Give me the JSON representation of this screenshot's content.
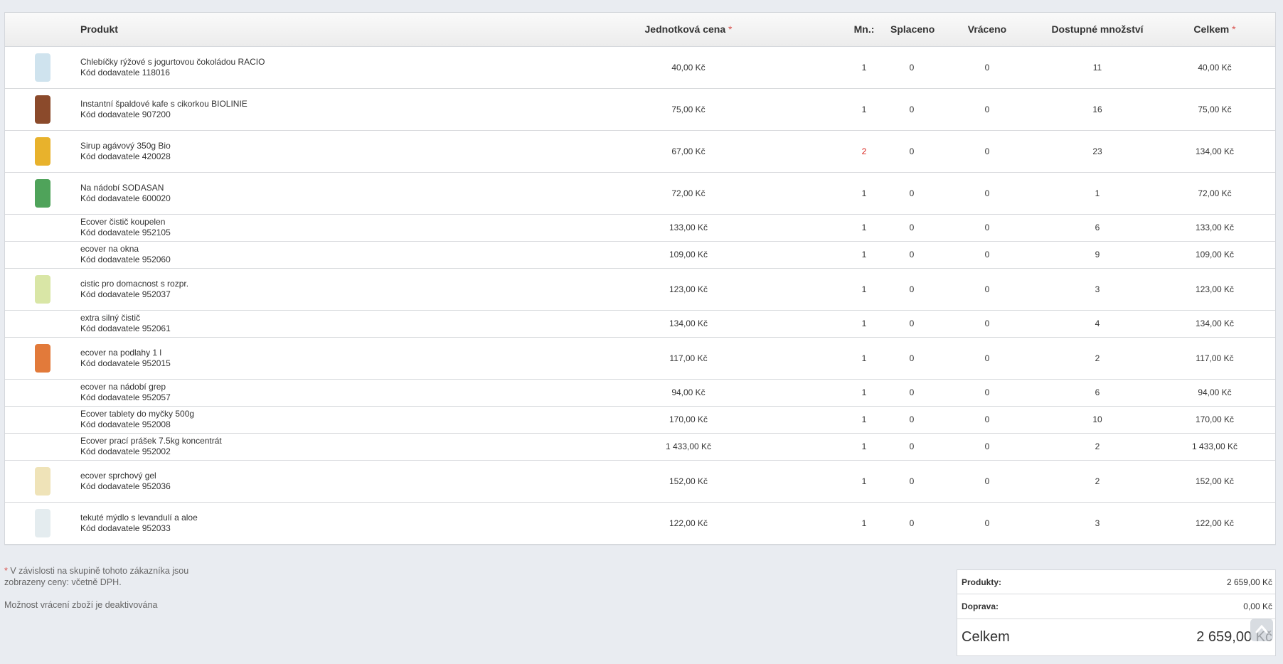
{
  "table": {
    "headers": {
      "product": "Produkt",
      "unit_price": "Jednotková cena",
      "qty": "Mn.:",
      "paid": "Splaceno",
      "returned": "Vráceno",
      "available": "Dostupné množství",
      "total": "Celkem",
      "asterisk": "*"
    },
    "rows": [
      {
        "name": "Chlebíčky rýžové s jogurtovou čokoládou RACIO",
        "code": "Kód dodavatele 118016",
        "price": "40,00 Kč",
        "qty": "1",
        "paid": "0",
        "returned": "0",
        "available": "11",
        "total": "40,00 Kč",
        "image": "light-blue-package",
        "img_color": "#cfe3ee"
      },
      {
        "name": "Instantní špaldové kafe s cikorkou BIOLINIE",
        "code": "Kód dodavatele 907200",
        "price": "75,00 Kč",
        "qty": "1",
        "paid": "0",
        "returned": "0",
        "available": "16",
        "total": "75,00 Kč",
        "image": "brown-can",
        "img_color": "#8b4a2b"
      },
      {
        "name": "Sirup agávový 350g Bio",
        "code": "Kód dodavatele 420028",
        "price": "67,00 Kč",
        "qty": "2",
        "paid": "0",
        "returned": "0",
        "available": "23",
        "total": "134,00 Kč",
        "image": "yellow-bottle",
        "img_color": "#e8b22c"
      },
      {
        "name": "Na nádobí SODASAN",
        "code": "Kód dodavatele 600020",
        "price": "72,00 Kč",
        "qty": "1",
        "paid": "0",
        "returned": "0",
        "available": "1",
        "total": "72,00 Kč",
        "image": "green-bottle",
        "img_color": "#4fa35a"
      },
      {
        "name": "Ecover čistič koupelen",
        "code": "Kód dodavatele 952105",
        "price": "133,00 Kč",
        "qty": "1",
        "paid": "0",
        "returned": "0",
        "available": "6",
        "total": "133,00 Kč",
        "image": "",
        "img_color": ""
      },
      {
        "name": "ecover na okna",
        "code": "Kód dodavatele 952060",
        "price": "109,00 Kč",
        "qty": "1",
        "paid": "0",
        "returned": "0",
        "available": "9",
        "total": "109,00 Kč",
        "image": "",
        "img_color": ""
      },
      {
        "name": "cistic pro domacnost s rozpr.",
        "code": "Kód dodavatele 952037",
        "price": "123,00 Kč",
        "qty": "1",
        "paid": "0",
        "returned": "0",
        "available": "3",
        "total": "123,00 Kč",
        "image": "spray-bottle",
        "img_color": "#d9e6a6"
      },
      {
        "name": "extra silný čistič",
        "code": "Kód dodavatele 952061",
        "price": "134,00 Kč",
        "qty": "1",
        "paid": "0",
        "returned": "0",
        "available": "4",
        "total": "134,00 Kč",
        "image": "",
        "img_color": ""
      },
      {
        "name": "ecover na podlahy 1 l",
        "code": "Kód dodavatele 952015",
        "price": "117,00 Kč",
        "qty": "1",
        "paid": "0",
        "returned": "0",
        "available": "2",
        "total": "117,00 Kč",
        "image": "orange-bottle",
        "img_color": "#e27a3a"
      },
      {
        "name": "ecover na nádobí grep",
        "code": "Kód dodavatele 952057",
        "price": "94,00 Kč",
        "qty": "1",
        "paid": "0",
        "returned": "0",
        "available": "6",
        "total": "94,00 Kč",
        "image": "",
        "img_color": ""
      },
      {
        "name": "Ecover tablety do myčky 500g",
        "code": "Kód dodavatele 952008",
        "price": "170,00 Kč",
        "qty": "1",
        "paid": "0",
        "returned": "0",
        "available": "10",
        "total": "170,00 Kč",
        "image": "",
        "img_color": ""
      },
      {
        "name": "Ecover prací prášek 7.5kg koncentrát",
        "code": "Kód dodavatele 952002",
        "price": "1 433,00 Kč",
        "qty": "1",
        "paid": "0",
        "returned": "0",
        "available": "2",
        "total": "1 433,00 Kč",
        "image": "",
        "img_color": ""
      },
      {
        "name": "ecover sprchový gel",
        "code": "Kód dodavatele 952036",
        "price": "152,00 Kč",
        "qty": "1",
        "paid": "0",
        "returned": "0",
        "available": "2",
        "total": "152,00 Kč",
        "image": "cream-bottle",
        "img_color": "#efe3b8"
      },
      {
        "name": "tekuté mýdlo s levandulí a aloe",
        "code": "Kód dodavatele 952033",
        "price": "122,00 Kč",
        "qty": "1",
        "paid": "0",
        "returned": "0",
        "available": "3",
        "total": "122,00 Kč",
        "image": "pump-bottle",
        "img_color": "#e4ecef"
      }
    ]
  },
  "note": {
    "asterisk": "*",
    "text": " V závislosti na skupině tohoto zákazníka jsou zobrazeny ceny: včetně DPH.",
    "return_text": "Možnost vrácení zboží je deaktivována"
  },
  "totals": {
    "products_label": "Produkty:",
    "products_value": "2 659,00 Kč",
    "shipping_label": "Doprava:",
    "shipping_value": "0,00 Kč",
    "total_label": "Celkem",
    "total_value": "2 659,00 Kč"
  },
  "icons": {
    "scroll_top": "chevron-up-icon"
  },
  "colors": {
    "high_qty": "#d9221b",
    "required_asterisk": "#d9534f"
  }
}
